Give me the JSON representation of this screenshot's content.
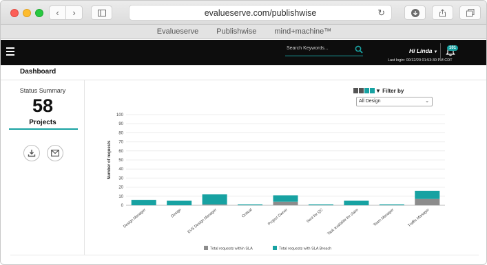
{
  "browser": {
    "url": "evalueserve.com/publishwise",
    "favorites": [
      "Evalueserve",
      "Publishwise",
      "mind+machine™"
    ]
  },
  "header": {
    "search_placeholder": "Search Keywords...",
    "greeting": "Hi Linda",
    "last_login": "Last login: 00/12/20 01:53:30 PM CDT",
    "notification_count": "101"
  },
  "page": {
    "title": "Dashboard"
  },
  "summary": {
    "label": "Status Summary",
    "count": "58",
    "count_label": "Projects"
  },
  "filter": {
    "label": "Filter by",
    "selected": "All Design"
  },
  "colors": {
    "accent": "#17a2a2",
    "within_sla": "#8c8c8c",
    "breach_sla": "#17a2a2",
    "header_bg": "#0d0d0d"
  },
  "chart_data": {
    "type": "bar",
    "stacked": true,
    "categories": [
      "Design Manager",
      "Design",
      "EVS Design Manager",
      "Ontical",
      "Project Owner",
      "Sent for QC",
      "Task available for claim",
      "Team Manager",
      "Traffic Manager"
    ],
    "series": [
      {
        "name": "Total requests within SLA",
        "values": [
          0,
          0,
          1,
          0,
          4,
          0,
          0,
          0,
          7
        ]
      },
      {
        "name": "Total requests with SLA Breach",
        "values": [
          6,
          5,
          11,
          1,
          7,
          1,
          5,
          1,
          9
        ]
      }
    ],
    "ylabel": "Number of requests",
    "xlabel": "",
    "ylim": [
      0,
      100
    ],
    "yticks": [
      "0",
      "10",
      "20",
      "30",
      "40",
      "50",
      "60",
      "70",
      "80",
      "90",
      "100"
    ],
    "grid": true,
    "legend": "bottom"
  }
}
